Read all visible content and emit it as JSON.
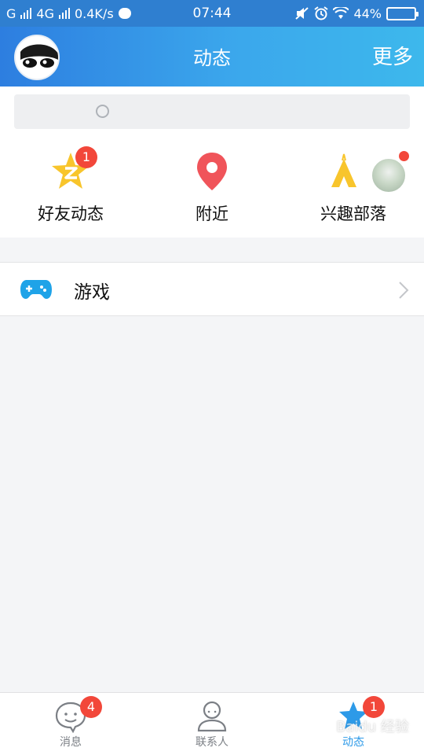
{
  "status_bar": {
    "carrier_1": "G",
    "carrier_2": "4G",
    "speed": "0.4K/s",
    "time": "07:44",
    "battery": "44%",
    "battery_level": 0.44
  },
  "header": {
    "title": "动态",
    "more": "更多"
  },
  "search": {
    "placeholder": ""
  },
  "quick": [
    {
      "label": "好友动态",
      "icon": "qzone-star-icon",
      "badge": "1"
    },
    {
      "label": "附近",
      "icon": "location-pin-icon"
    },
    {
      "label": "兴趣部落",
      "icon": "tribe-tent-icon"
    }
  ],
  "games": {
    "label": "游戏",
    "icon": "gamepad-icon"
  },
  "tabs": [
    {
      "label": "消息",
      "icon": "message-bubble-icon",
      "badge": "4"
    },
    {
      "label": "联系人",
      "icon": "contacts-person-icon"
    },
    {
      "label": "动态",
      "icon": "star-dynamic-icon",
      "badge": "1",
      "active": true
    }
  ],
  "watermark": "Baidu 经验",
  "colors": {
    "header_start": "#2d7ee0",
    "header_end": "#3db8ec",
    "badge": "#f2473a",
    "active_tab": "#2d9ae8",
    "pin": "#f0545a",
    "star": "#f8c52c",
    "gamepad": "#1fa3e8"
  }
}
